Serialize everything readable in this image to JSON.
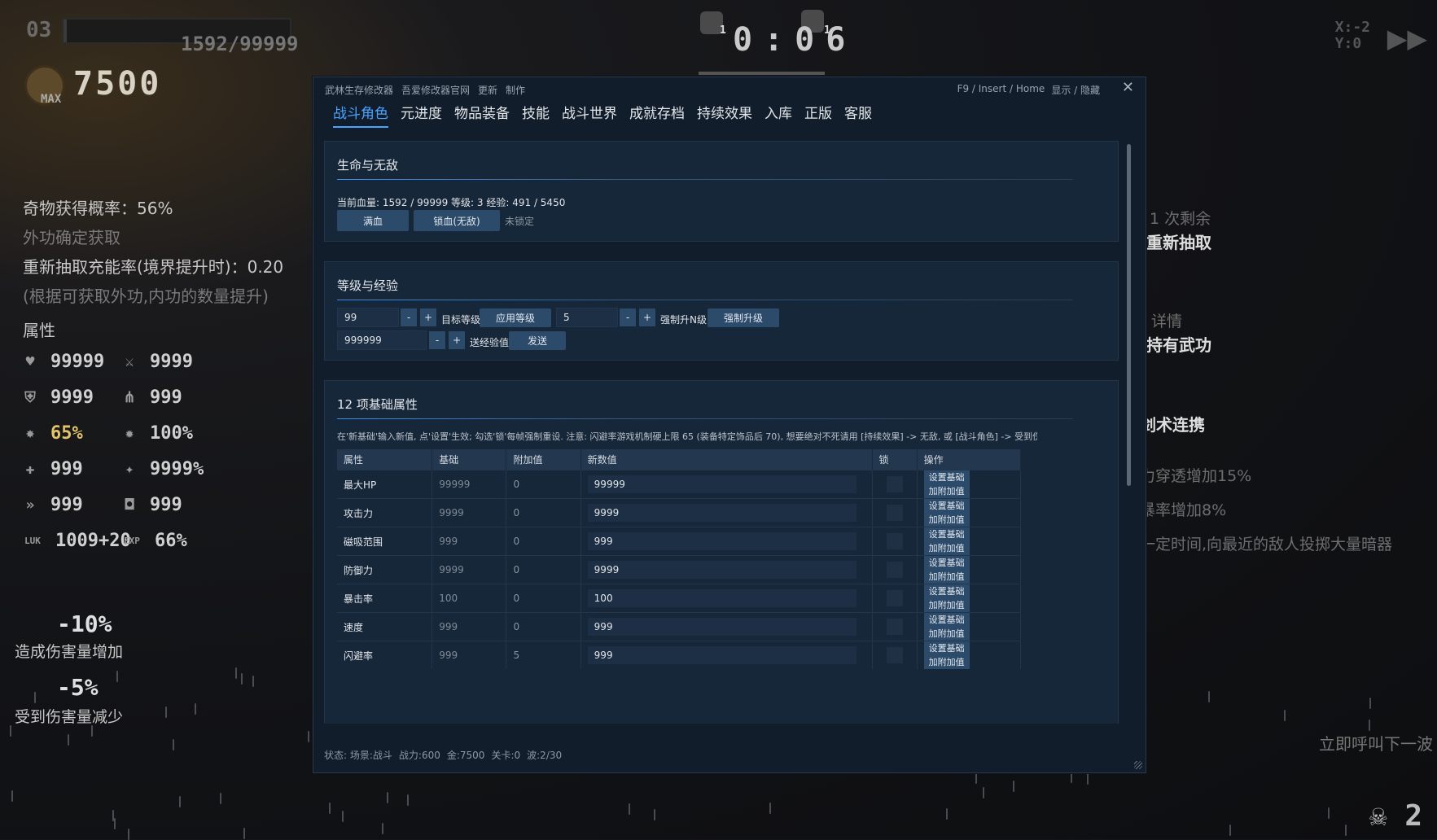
{
  "game": {
    "level": "03",
    "xp_fraction": 0.016,
    "xp_text": "1592/99999",
    "gold_max": "MAX",
    "gold": "7500",
    "timer": "0:06",
    "top_icon_counts": [
      "1",
      "1"
    ],
    "coords": {
      "x": "X:-2",
      "y": "Y:0"
    },
    "stats": [
      {
        "text": "奇物获得概率：56%",
        "dim": false
      },
      {
        "text": "外功确定获取",
        "dim": true
      },
      {
        "text": "重新抽取充能率(境界提升时)：0.20",
        "dim": false
      },
      {
        "text": "(根据可获取外功,内功的数量提升)",
        "dim": true
      }
    ],
    "attr_heading": "属性",
    "attrs": [
      {
        "icon": "heart-icon",
        "glyph": "♥",
        "value": "99999",
        "gold": false
      },
      {
        "icon": "sword-icon",
        "glyph": "⚔",
        "value": "9999",
        "gold": false
      },
      {
        "icon": "shield-icon",
        "glyph": "⛨",
        "value": "9999",
        "gold": false
      },
      {
        "icon": "magnet-icon",
        "glyph": "⋔",
        "value": "999",
        "gold": false
      },
      {
        "icon": "crit-icon",
        "glyph": "✸",
        "value": "65%",
        "gold": true
      },
      {
        "icon": "crit-damage-icon",
        "glyph": "✹",
        "value": "100%",
        "gold": false
      },
      {
        "icon": "regen-icon",
        "glyph": "✚",
        "value": "999",
        "gold": false
      },
      {
        "icon": "dodge-icon",
        "glyph": "✦",
        "value": "9999%",
        "gold": false
      },
      {
        "icon": "speed-icon",
        "glyph": "»",
        "value": "999",
        "gold": false
      },
      {
        "icon": "armor-icon",
        "glyph": "◘",
        "value": "999",
        "gold": false
      },
      {
        "icon": "luk-label",
        "glyph": "LUK",
        "value": "1009+20",
        "gold": false
      },
      {
        "icon": "exp-label",
        "glyph": "EXP",
        "value": "66%",
        "gold": false
      }
    ],
    "damage_out": {
      "value": "-10%",
      "label": "造成伤害量增加"
    },
    "damage_in": {
      "value": "-5%",
      "label": "受到伤害量减少"
    },
    "right_panel": [
      {
        "text": "1 次剩余",
        "style": "dim"
      },
      {
        "text": "重新抽取",
        "style": "bold"
      },
      {
        "text": "详情",
        "style": "dim"
      },
      {
        "text": "持有武功",
        "style": "bold"
      },
      {
        "text": "剑术连携",
        "style": "bold"
      },
      {
        "text": "力穿透增加15%",
        "style": "dim"
      },
      {
        "text": "暴率增加8%",
        "style": "dim"
      },
      {
        "text": "一定时间,向最近的敌人投掷大量暗器",
        "style": "dim"
      }
    ],
    "summon_text": "立即呼叫下一波",
    "skull_count": "2"
  },
  "trainer": {
    "menu": [
      "武林生存修改器",
      "吾爱修改器官网",
      "更新",
      "制作"
    ],
    "hotkey": "F9 / Insert / Home",
    "toggle_label": "显示 / 隐藏",
    "close": "✕",
    "tabs": [
      "战斗角色",
      "元进度",
      "物品装备",
      "技能",
      "战斗世界",
      "成就存档",
      "持续效果",
      "入库",
      "正版",
      "客服"
    ],
    "active_tab": 0,
    "life": {
      "title": "生命与无敌",
      "info": "当前血量: 1592 / 99999    等级: 3    经验: 491 / 5450",
      "full_hp_btn": "满血",
      "lock_hp_btn": "锁血(无敌)",
      "lock_status": "未锁定"
    },
    "level": {
      "title": "等级与经验",
      "target_level_value": "99",
      "target_level_label": "目标等级",
      "apply_level_btn": "应用等级",
      "force_n_value": "5",
      "force_n_label": "强制升N级",
      "force_btn": "强制升级",
      "exp_value": "999999",
      "exp_label": "送经验值",
      "send_btn": "发送",
      "minus": "-",
      "plus": "+"
    },
    "attrs": {
      "title": "12 项基础属性",
      "note": "在'新基础'输入新值, 点'设置'生效; 勾选'锁'每帧强制重设. 注意: 闪避率游戏机制硬上限 65 (装备特定饰品后 70), 想要绝对不死请用 [持续效果] -> 无敌, 或 [战斗角色] -> 受到伤害=-",
      "columns": [
        "属性",
        "基础",
        "附加值",
        "新数值",
        "锁",
        "操作"
      ],
      "set_btn": "设置基础",
      "add_btn": "加附加值",
      "rows": [
        {
          "name": "最大HP",
          "base": "99999",
          "add": "0",
          "new": "99999"
        },
        {
          "name": "攻击力",
          "base": "9999",
          "add": "0",
          "new": "9999"
        },
        {
          "name": "磁吸范围",
          "base": "999",
          "add": "0",
          "new": "999"
        },
        {
          "name": "防御力",
          "base": "9999",
          "add": "0",
          "new": "9999"
        },
        {
          "name": "暴击率",
          "base": "100",
          "add": "0",
          "new": "100"
        },
        {
          "name": "速度",
          "base": "999",
          "add": "0",
          "new": "999"
        },
        {
          "name": "闪避率",
          "base": "999",
          "add": "5",
          "new": "999"
        }
      ]
    },
    "status": [
      "状态: 场景:战斗",
      "战力:600",
      "金:7500",
      "关卡:0",
      "波:2/30"
    ]
  }
}
